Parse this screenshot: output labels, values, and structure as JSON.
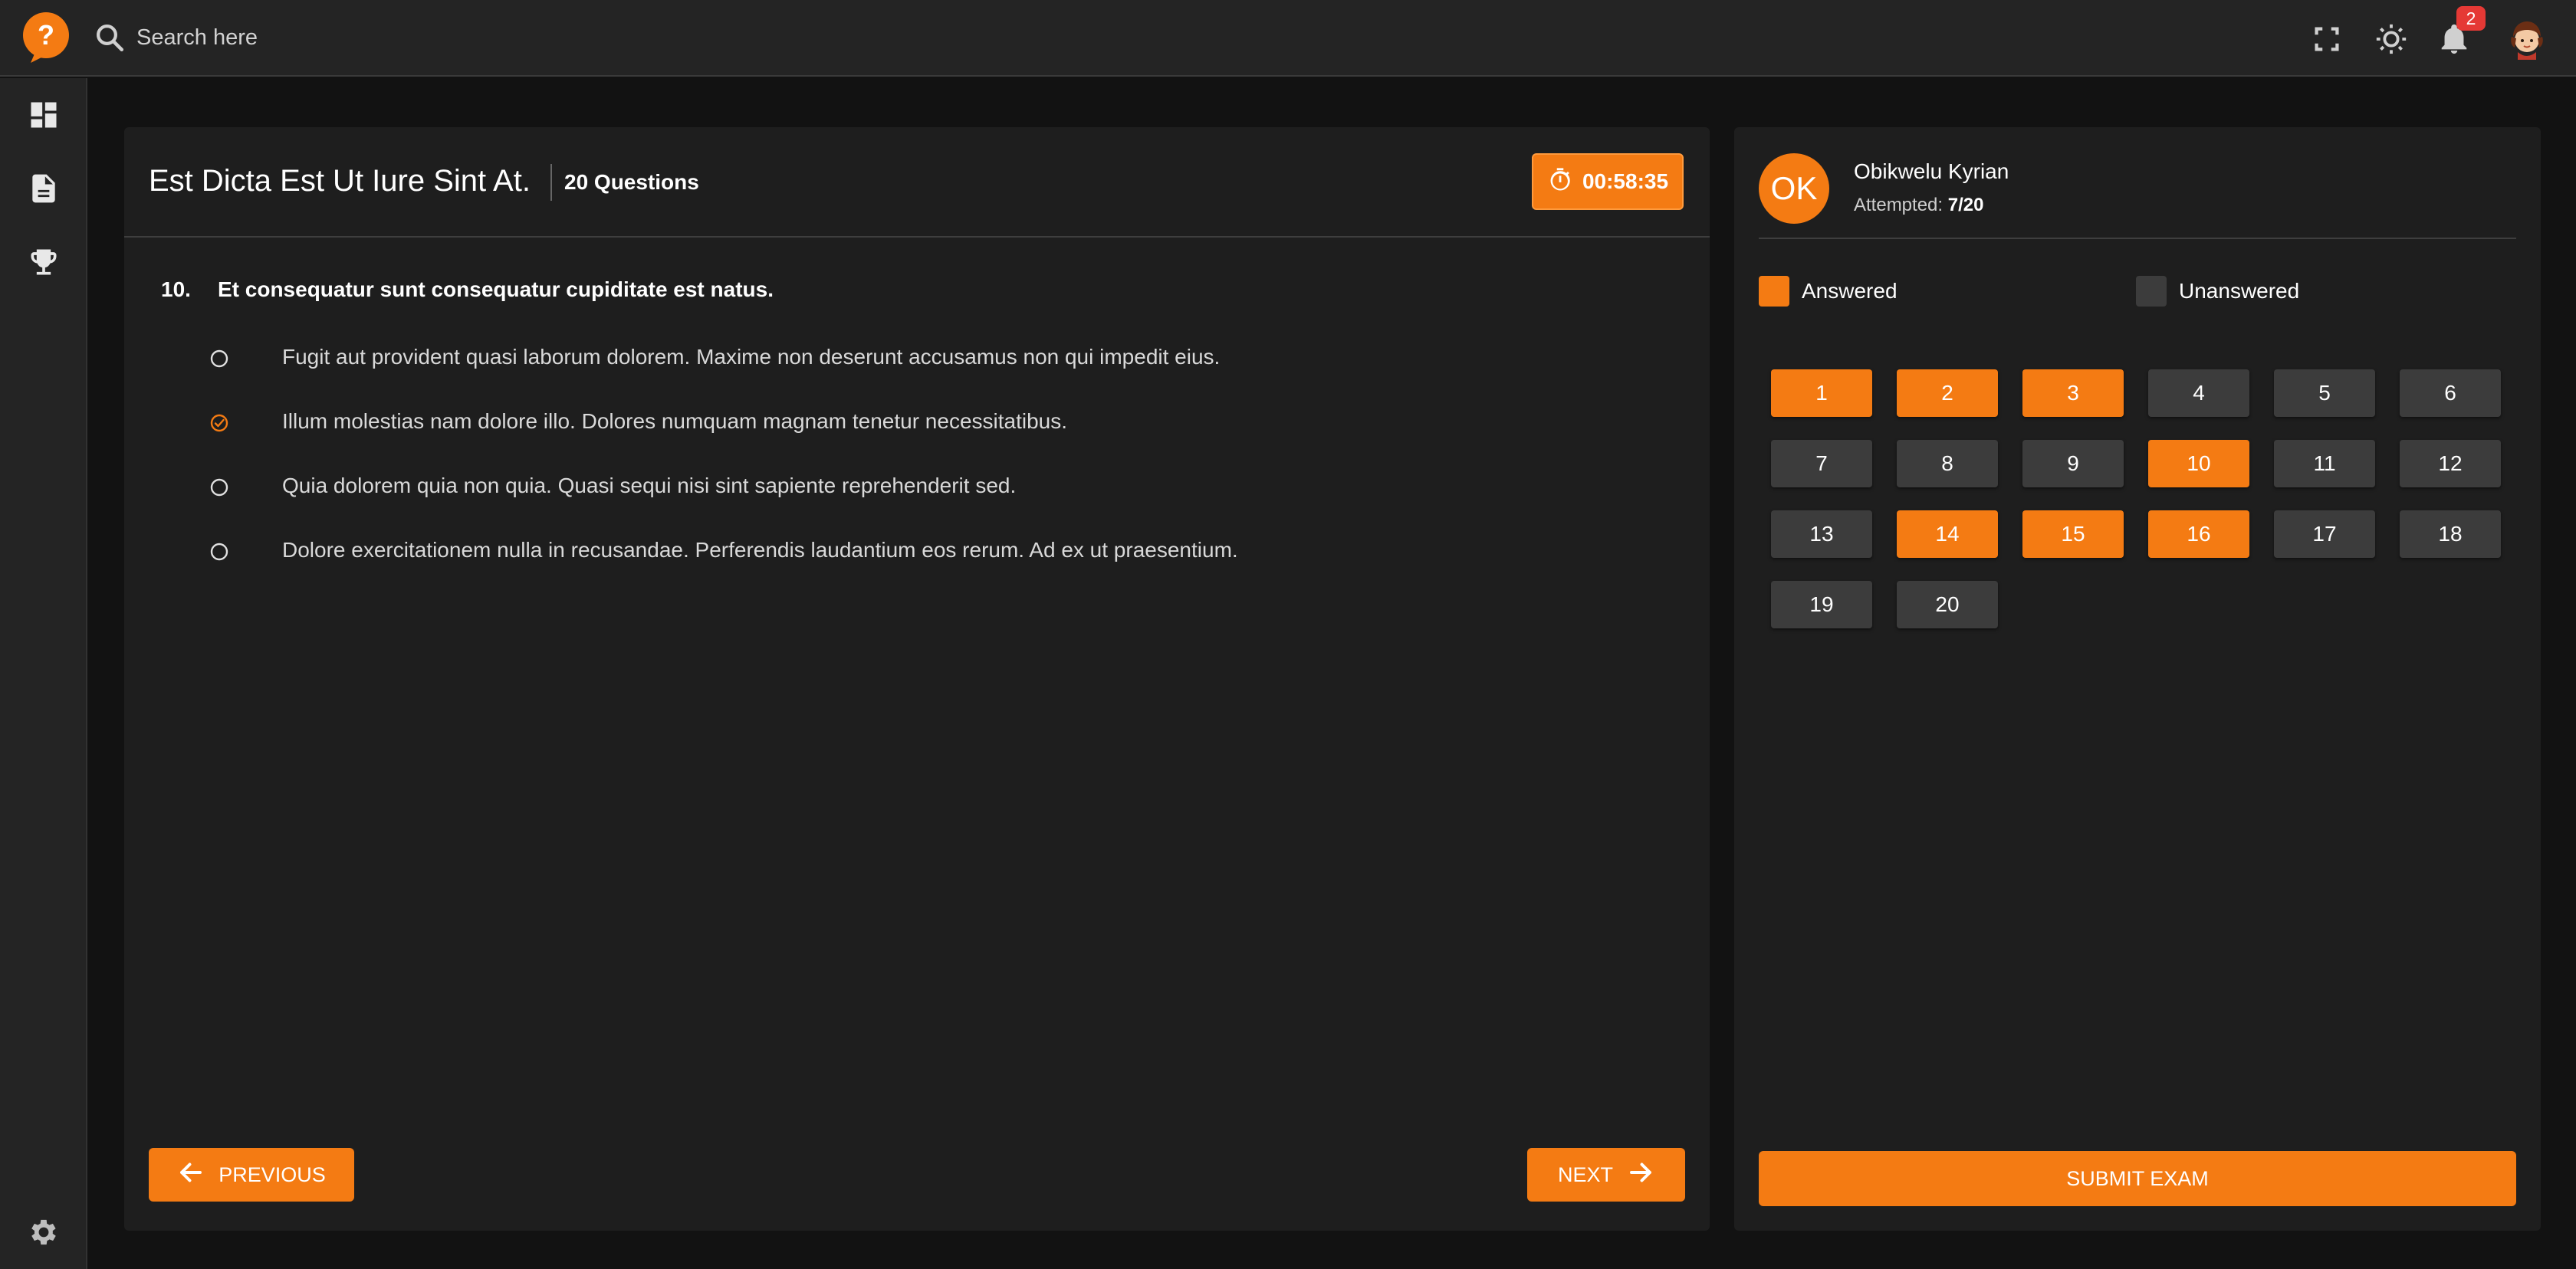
{
  "header": {
    "search": {
      "placeholder": "Search here",
      "value": ""
    },
    "notification_count": "2",
    "icons": [
      "app-logo-icon",
      "search-icon",
      "fullscreen-icon",
      "theme-toggle-icon",
      "bell-icon",
      "user-avatar-icon"
    ]
  },
  "sidebar": {
    "items": [
      {
        "icon": "dashboard-icon"
      },
      {
        "icon": "document-icon"
      },
      {
        "icon": "trophy-icon"
      }
    ],
    "footer_icon": "settings-icon"
  },
  "exam": {
    "title": "Est Dicta Est Ut Iure Sint At.",
    "question_count": "20 Questions",
    "timer": "00:58:35"
  },
  "question": {
    "number": "10.",
    "text": "Et consequatur sunt consequatur cupiditate est natus.",
    "options": [
      {
        "text": "Fugit aut provident quasi laborum dolorem. Maxime non deserunt accusamus non qui impedit eius.",
        "selected": false
      },
      {
        "text": "Illum molestias nam dolore illo. Dolores numquam magnam tenetur necessitatibus.",
        "selected": true
      },
      {
        "text": "Quia dolorem quia non quia. Quasi sequi nisi sint sapiente reprehenderit sed.",
        "selected": false
      },
      {
        "text": "Dolore exercitationem nulla in recusandae. Perferendis laudantium eos rerum. Ad ex ut praesentium.",
        "selected": false
      }
    ]
  },
  "nav": {
    "previous": "PREVIOUS",
    "next": "NEXT"
  },
  "user": {
    "initials": "OK",
    "name": "Obikwelu Kyrian",
    "attempted_label": "Attempted:",
    "attempted_value": "7/20"
  },
  "legend": {
    "answered": "Answered",
    "unanswered": "Unanswered"
  },
  "questions_grid": [
    {
      "n": "1",
      "answered": true
    },
    {
      "n": "2",
      "answered": true
    },
    {
      "n": "3",
      "answered": true
    },
    {
      "n": "4",
      "answered": false
    },
    {
      "n": "5",
      "answered": false
    },
    {
      "n": "6",
      "answered": false
    },
    {
      "n": "7",
      "answered": false
    },
    {
      "n": "8",
      "answered": false
    },
    {
      "n": "9",
      "answered": false
    },
    {
      "n": "10",
      "answered": true
    },
    {
      "n": "11",
      "answered": false
    },
    {
      "n": "12",
      "answered": false
    },
    {
      "n": "13",
      "answered": false
    },
    {
      "n": "14",
      "answered": true
    },
    {
      "n": "15",
      "answered": true
    },
    {
      "n": "16",
      "answered": true
    },
    {
      "n": "17",
      "answered": false
    },
    {
      "n": "18",
      "answered": false
    },
    {
      "n": "19",
      "answered": false
    },
    {
      "n": "20",
      "answered": false
    }
  ],
  "submit": "SUBMIT EXAM",
  "colors": {
    "accent": "#f47b13",
    "unanswered": "#3c3c3c",
    "panel": "#1e1e1e",
    "background": "#121212"
  }
}
